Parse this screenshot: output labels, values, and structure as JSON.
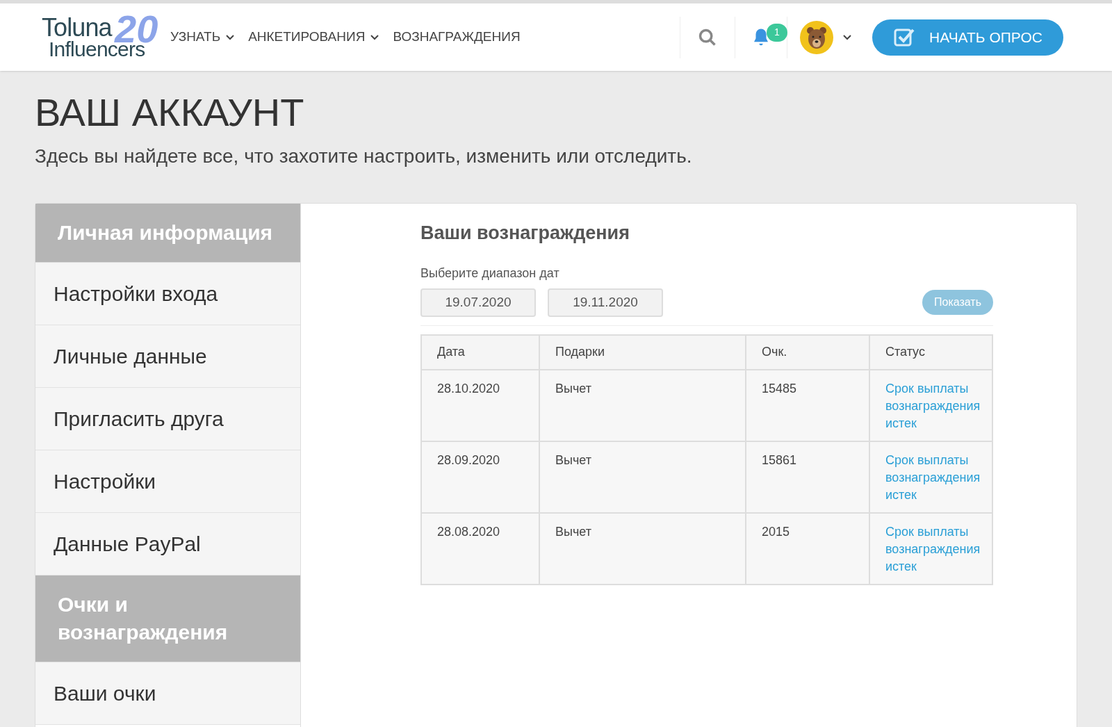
{
  "header": {
    "logo": {
      "line1": "Toluna",
      "line2": "Influencers",
      "anniversary": "20"
    },
    "nav": [
      {
        "label": "УЗНАТЬ",
        "dropdown": true
      },
      {
        "label": "АНКЕТИРОВАНИЯ",
        "dropdown": true
      },
      {
        "label": "ВОЗНАГРАЖДЕНИЯ",
        "dropdown": false
      }
    ],
    "notification_count": "1",
    "cta": "НАЧАТЬ ОПРОС"
  },
  "page": {
    "title": "ВАШ АККАУНТ",
    "subtitle": "Здесь вы найдете все, что захотите настроить, изменить или отследить."
  },
  "sidebar": {
    "items": [
      {
        "kind": "header",
        "label": "Личная информация"
      },
      {
        "kind": "link",
        "label": "Настройки входа"
      },
      {
        "kind": "link",
        "label": "Личные данные"
      },
      {
        "kind": "link",
        "label": "Пригласить друга"
      },
      {
        "kind": "link",
        "label": "Настройки"
      },
      {
        "kind": "link",
        "label": "Данные PayPal"
      },
      {
        "kind": "header",
        "label": "Очки и вознаграждения"
      },
      {
        "kind": "link",
        "label": "Ваши очки"
      }
    ]
  },
  "rewards": {
    "title": "Ваши вознаграждения",
    "range_label": "Выберите диапазон дат",
    "date_from": "19.07.2020",
    "date_to": "19.11.2020",
    "show_button": "Показать",
    "table": {
      "columns": [
        "Дата",
        "Подарки",
        "Очк.",
        "Статус"
      ],
      "rows": [
        [
          "28.10.2020",
          "Вычет",
          "15485",
          "Срок выплаты вознаграждения истек"
        ],
        [
          "28.09.2020",
          "Вычет",
          "15861",
          "Срок выплаты вознаграждения истек"
        ],
        [
          "28.08.2020",
          "Вычет",
          "2015",
          "Срок выплаты вознаграждения истек"
        ]
      ]
    }
  }
}
